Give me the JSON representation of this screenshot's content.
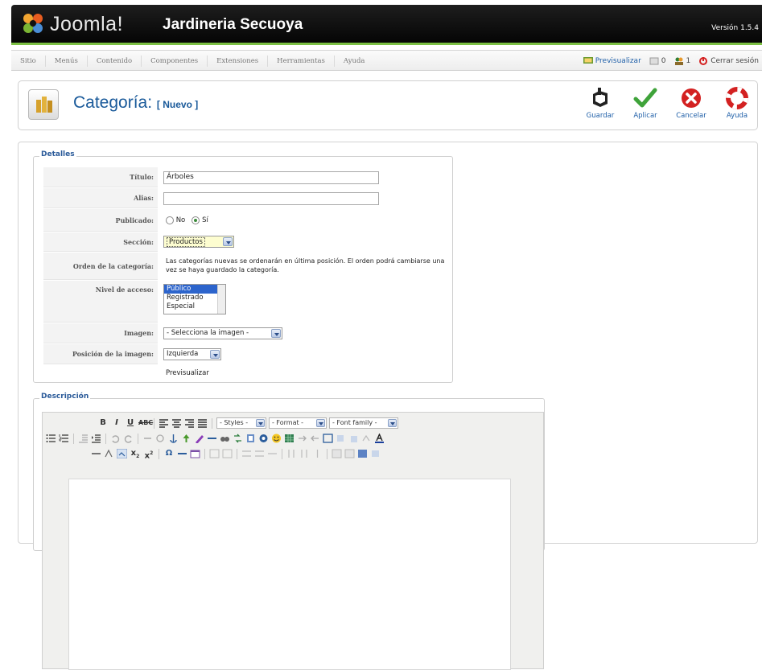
{
  "header": {
    "logo_text": "Joomla!",
    "site_name": "Jardineria Secuoya",
    "version": "Versión 1.5.4"
  },
  "menu": [
    "Sitio",
    "Menús",
    "Contenido",
    "Componentes",
    "Extensiones",
    "Herramientas",
    "Ayuda"
  ],
  "status": {
    "preview_label": "Previsualizar",
    "messages_count": "0",
    "users_count": "1",
    "logout_label": "Cerrar sesión"
  },
  "page": {
    "title": "Categoría:",
    "subtitle": "[ Nuevo ]"
  },
  "toolbar": {
    "save_label": "Guardar",
    "apply_label": "Aplicar",
    "cancel_label": "Cancelar",
    "help_label": "Ayuda"
  },
  "details": {
    "legend": "Detalles",
    "title_label": "Título:",
    "title_value": "Árboles",
    "alias_label": "Alias:",
    "alias_value": "",
    "published_label": "Publicado:",
    "published_no": "No",
    "published_yes": "Sí",
    "published_selected": "Sí",
    "section_label": "Sección:",
    "section_value": "Productos",
    "order_label": "Orden de la categoría:",
    "order_text": "Las categorías nuevas se ordenarán en última posición. El orden podrá cambiarse una vez se haya guardado la categoría.",
    "access_label": "Nivel de acceso:",
    "access_options": [
      "Público",
      "Registrado",
      "Especial"
    ],
    "access_selected": "Público",
    "image_label": "Imagen:",
    "image_value": "- Selecciona la imagen -",
    "image_position_label": "Posición de la imagen:",
    "image_position_value": "Izquierda",
    "preview_label": "Previsualizar"
  },
  "description": {
    "legend": "Descripción",
    "styles_select": "- Styles -",
    "format_select": "- Format -",
    "font_select": "- Font family -"
  },
  "colors": {
    "topbar": "#0a0a0a",
    "accent_green": "#7cc043",
    "title_blue": "#1a5a9a",
    "link_blue": "#1f5fa8"
  }
}
